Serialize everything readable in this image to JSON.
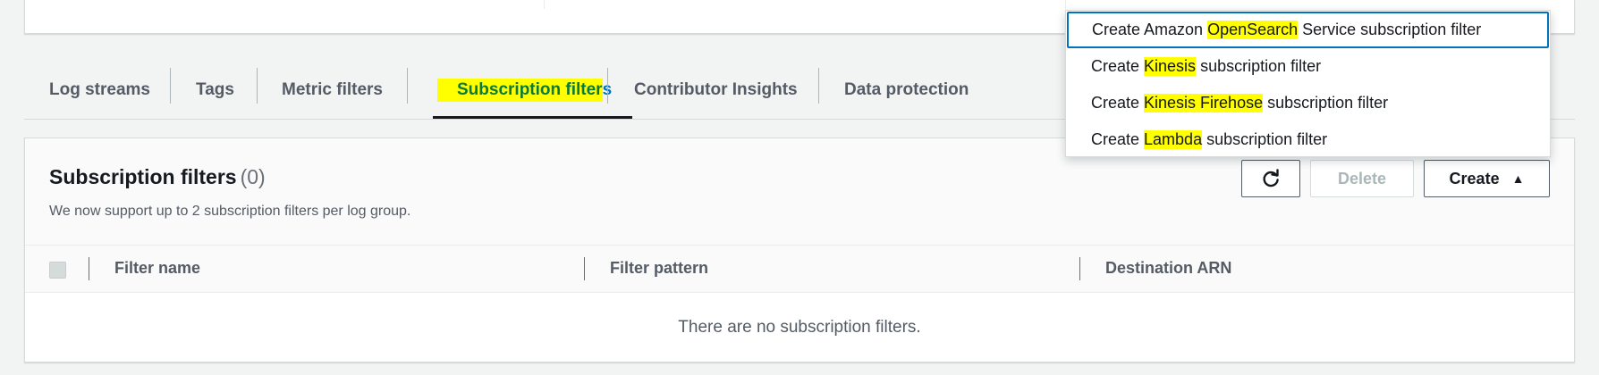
{
  "tabs": [
    {
      "label": "Log streams"
    },
    {
      "label": "Tags"
    },
    {
      "label": "Metric filters"
    },
    {
      "label_hl": "Subscription filter",
      "label_rest": "s"
    },
    {
      "label": "Contributor Insights"
    },
    {
      "label": "Data protection"
    }
  ],
  "panel": {
    "title": "Subscription filters",
    "count": "(0)",
    "description": "We now support up to 2 subscription filters per log group.",
    "refresh_icon": "refresh-icon",
    "delete_label": "Delete",
    "create_label": "Create",
    "create_caret": "▲"
  },
  "table": {
    "columns": [
      "Filter name",
      "Filter pattern",
      "Destination ARN"
    ],
    "empty_text": "There are no subscription filters."
  },
  "dropdown": {
    "items": [
      {
        "pre": "Create Amazon ",
        "hl": "OpenSearch",
        "post": " Service subscription filter"
      },
      {
        "pre": "Create ",
        "hl": "Kinesis",
        "post": " subscription filter"
      },
      {
        "pre": "Create ",
        "hl": "Kinesis Firehose",
        "post": " subscription filter"
      },
      {
        "pre": "Create ",
        "hl": "Lambda",
        "post": " subscription filter"
      }
    ]
  },
  "colors": {
    "highlight": "#ffff00",
    "accent": "#0073bb",
    "active_tab_text": "#0a7a3a"
  }
}
